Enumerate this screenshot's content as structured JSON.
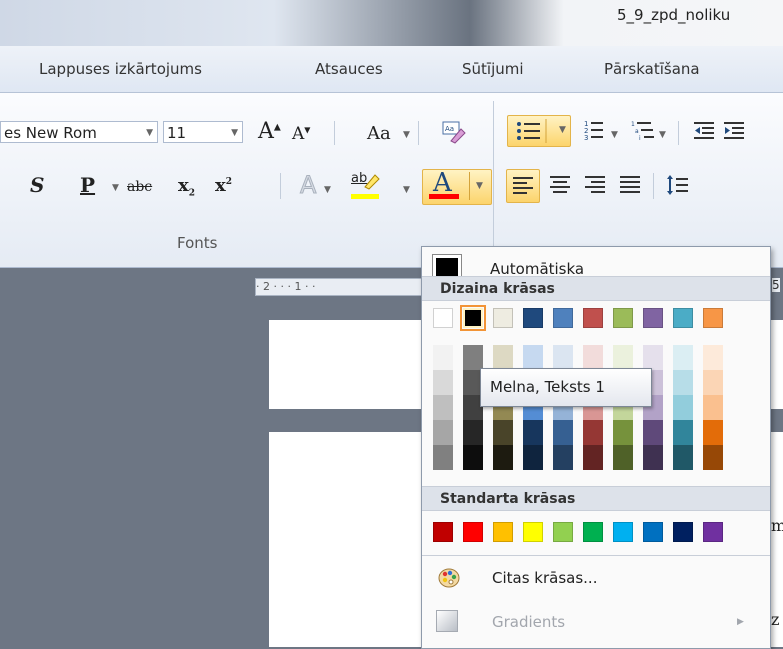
{
  "title_bar": {
    "document_title": "5_9_zpd_noliku"
  },
  "ribbon_tabs": [
    "Lappuses izkārtojums",
    "Atsauces",
    "Sūtījumi",
    "Pārskatīšana"
  ],
  "font_group": {
    "font_name": "es New Rom",
    "font_size": "11",
    "grow_glyph": "A",
    "shrink_glyph": "A",
    "change_case": "Aa",
    "group_label": "Fonts",
    "strike_glyph": "abc",
    "sub_glyph": "x",
    "sup_glyph": "x",
    "bold_glyph": "S",
    "underline_glyph": "P",
    "highlight_glyph": "ab",
    "font_color_glyph": "A"
  },
  "ruler": {
    "text": "· 2 · · · 1 · ·",
    "right_mark": "5"
  },
  "doc_fragments": [
    "m",
    "z"
  ],
  "color_menu": {
    "automatic_label": "Automātiska",
    "theme_colors_title": "Dizaina krāsas",
    "standard_colors_title": "Standarta krāsas",
    "more_colors_label": "Citas krāsas...",
    "gradients_label": "Gradients",
    "tooltip": "Melna, Teksts 1",
    "theme_colors": [
      "#ffffff",
      "#000000",
      "#eeece1",
      "#1f497d",
      "#4f81bd",
      "#c0504d",
      "#9bbb59",
      "#8064a2",
      "#4bacc6",
      "#f79646"
    ],
    "theme_shades": [
      [
        "#f2f2f2",
        "#d9d9d9",
        "#bfbfbf",
        "#a6a6a6",
        "#808080"
      ],
      [
        "#7f7f7f",
        "#595959",
        "#404040",
        "#262626",
        "#0d0d0d"
      ],
      [
        "#ddd9c3",
        "#c4bd97",
        "#938953",
        "#494429",
        "#1d1b10"
      ],
      [
        "#c6d9f0",
        "#8db3e2",
        "#548dd4",
        "#17365d",
        "#0f243e"
      ],
      [
        "#dbe5f1",
        "#b8cce4",
        "#95b3d7",
        "#366092",
        "#244061"
      ],
      [
        "#f2dcdb",
        "#e5b9b7",
        "#d99694",
        "#953734",
        "#632423"
      ],
      [
        "#ebf1dd",
        "#d7e3bc",
        "#c3d69b",
        "#76923c",
        "#4f6128"
      ],
      [
        "#e5e0ec",
        "#ccc1d9",
        "#b2a2c7",
        "#5f497a",
        "#3f3151"
      ],
      [
        "#dbeef3",
        "#b7dde8",
        "#92cddc",
        "#31859b",
        "#205867"
      ],
      [
        "#fdeada",
        "#fbd5b5",
        "#fac08f",
        "#e36c09",
        "#974806"
      ]
    ],
    "standard_colors": [
      "#c00000",
      "#ff0000",
      "#ffc000",
      "#ffff00",
      "#92d050",
      "#00b050",
      "#00b0f0",
      "#0070c0",
      "#002060",
      "#7030a0"
    ]
  }
}
